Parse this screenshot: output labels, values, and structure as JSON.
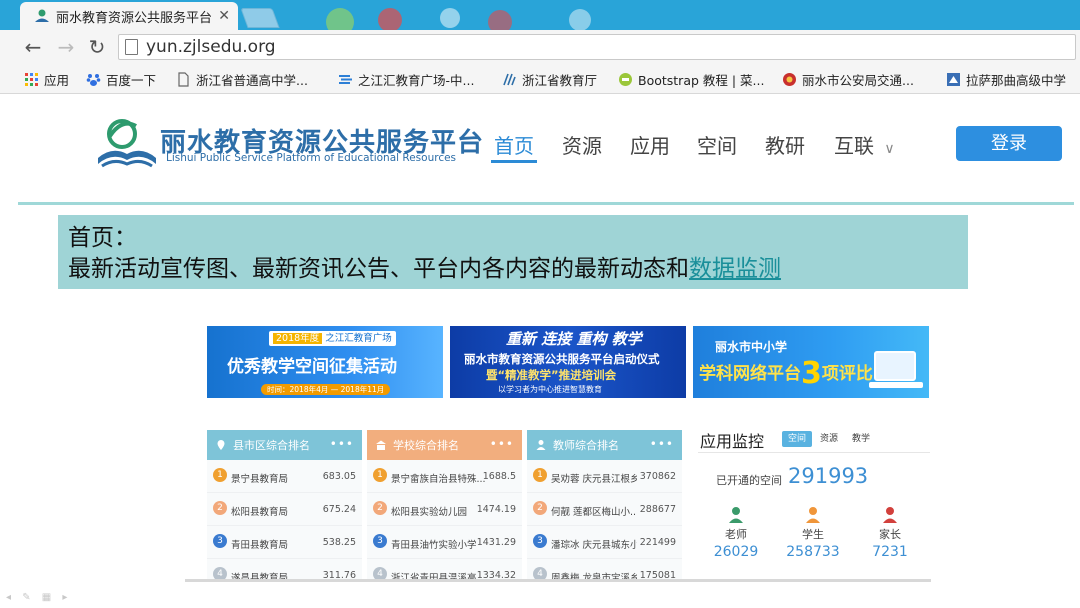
{
  "browser": {
    "tab_title": "丽水教育资源公共服务平台",
    "url": "yun.zjlsedu.org",
    "bookmarks": [
      "应用",
      "百度一下",
      "浙江省普通高中学...",
      "之江汇教育广场-中...",
      "浙江省教育厅",
      "Bootstrap 教程 | 菜...",
      "丽水市公安局交通...",
      "拉萨那曲高级中学"
    ]
  },
  "site": {
    "logo_cn": "丽水教育资源公共服务平台",
    "logo_en": "Lishui Public Service Platform of Educational Resources",
    "nav": [
      "首页",
      "资源",
      "应用",
      "空间",
      "教研",
      "互联"
    ],
    "login": "登录"
  },
  "annotation": {
    "title": "首页：",
    "body": "最新活动宣传图、最新资讯公告、平台内各内容的最新动态和",
    "link": "数据监测"
  },
  "banners": {
    "b1_tag_year": "2018年度",
    "b1_tag": "之江汇教育广场",
    "b1_main": "优秀教学空间征集活动",
    "b1_sub": "时间：2018年4月 — 2018年11月",
    "b2_head": "重新 连接 重构 教学",
    "b2_l1": "丽水市教育资源公共服务平台启动仪式",
    "b2_l2": "暨“精准教学”推进培训会",
    "b2_l3": "以学习者为中心推进智慧教育",
    "b3_l1": "丽水市中小学",
    "b3_l2_a": "学科网络平台",
    "b3_l2_num": "3",
    "b3_l2_b": "项评比"
  },
  "rankings": [
    {
      "title": "县市区综合排名",
      "rows": [
        {
          "rank": "1",
          "name": "景宁县教育局",
          "score": "683.05"
        },
        {
          "rank": "2",
          "name": "松阳县教育局",
          "score": "675.24"
        },
        {
          "rank": "3",
          "name": "青田县教育局",
          "score": "538.25"
        },
        {
          "rank": "4",
          "name": "遂昌县教育局",
          "score": "311.76"
        }
      ]
    },
    {
      "title": "学校综合排名",
      "rows": [
        {
          "rank": "1",
          "name": "景宁畲族自治县特殊...",
          "score": "1688.5"
        },
        {
          "rank": "2",
          "name": "松阳县实验幼儿园",
          "score": "1474.19"
        },
        {
          "rank": "3",
          "name": "青田县油竹实验小学",
          "score": "1431.29"
        },
        {
          "rank": "4",
          "name": "浙江省青田县温溪高...",
          "score": "1334.32"
        }
      ]
    },
    {
      "title": "教师综合排名",
      "rows": [
        {
          "rank": "1",
          "name": "吴劝蓉  庆元县江根乡...",
          "score": "370862"
        },
        {
          "rank": "2",
          "name": "何靓  莲都区梅山小...",
          "score": "288677"
        },
        {
          "rank": "3",
          "name": "潘琮冰  庆元县城东小...",
          "score": "221499"
        },
        {
          "rank": "4",
          "name": "周鑫梅  龙泉市宝溪乡...",
          "score": "175081"
        }
      ]
    }
  ],
  "monitor": {
    "title": "应用监控",
    "tabs": [
      "空间",
      "资源",
      "教学"
    ],
    "label": "已开通的空间",
    "total": "291993",
    "stats": [
      {
        "label": "老师",
        "value": "26029"
      },
      {
        "label": "学生",
        "value": "258733"
      },
      {
        "label": "家长",
        "value": "7231"
      }
    ]
  },
  "colors": {
    "accent": "#2c8bd6",
    "annotation_bg": "#9fd4d6",
    "login_bg": "#2d8fe0",
    "gold": "#f0a030",
    "silver": "#f2a87a",
    "bronze": "#3a7bd0"
  }
}
